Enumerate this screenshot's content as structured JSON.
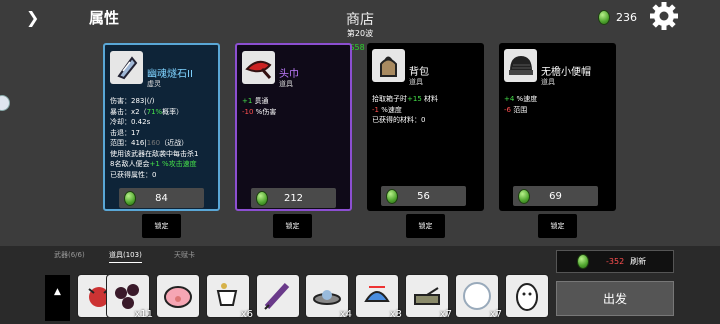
{
  "topbar": {
    "expand_icon": "chevron-right-icon",
    "title": "属性",
    "shop_title": "商店",
    "wave": "第20波",
    "fps": "FPS58",
    "currency": "236",
    "settings_icon": "gear-icon"
  },
  "cards": [
    {
      "name": "幽魂燧石II",
      "type": "虚灵",
      "name_color": "#7fd3ff",
      "price": "84",
      "lock": "锁定",
      "lines": [
        [
          {
            "t": "伤害：283|(/)"
          }
        ],
        [
          {
            "t": "暴击：x2（"
          },
          {
            "t": "71%",
            "c": "g"
          },
          {
            "t": "概率）"
          }
        ],
        [
          {
            "t": "冷却：0.42s"
          }
        ],
        [
          {
            "t": "击退：17"
          }
        ],
        [
          {
            "t": "范围：416|"
          },
          {
            "t": "160",
            "c": "gray"
          },
          {
            "t": "（近战）"
          }
        ],
        [
          {
            "t": "使用该武器在敌袭中每击杀1"
          }
        ],
        [
          {
            "t": "8名敌人便会"
          },
          {
            "t": "+1 %攻击速度",
            "c": "g"
          }
        ],
        [
          {
            "t": "已获得属性：0"
          }
        ]
      ]
    },
    {
      "name": "头巾",
      "type": "道具",
      "name_color": "#c07cff",
      "price": "212",
      "lock": "锁定",
      "lines": [
        [
          {
            "t": "+1",
            "c": "g"
          },
          {
            "t": " 贯通"
          }
        ],
        [
          {
            "t": "-10",
            "c": "r"
          },
          {
            "t": " %伤害"
          }
        ]
      ]
    },
    {
      "name": "背包",
      "type": "道具",
      "name_color": "#ffffff",
      "price": "56",
      "lock": "锁定",
      "lines": [
        [
          {
            "t": "拾取箱子时"
          },
          {
            "t": "+15",
            "c": "g"
          },
          {
            "t": " 材料"
          }
        ],
        [
          {
            "t": "-1",
            "c": "r"
          },
          {
            "t": " %速度"
          }
        ],
        [
          {
            "t": "已获得的材料：0"
          }
        ]
      ]
    },
    {
      "name": "无檐小便帽",
      "type": "道具",
      "name_color": "#ffffff",
      "price": "69",
      "lock": "锁定",
      "lines": [
        [
          {
            "t": "+4",
            "c": "g"
          },
          {
            "t": " %速度"
          }
        ],
        [
          {
            "t": "-6",
            "c": "r"
          },
          {
            "t": " 范围"
          }
        ]
      ]
    }
  ],
  "tabs": [
    {
      "label": "武器(6/6)"
    },
    {
      "label": "道具(103)"
    },
    {
      "label": "天赋卡"
    }
  ],
  "inventory": [
    {
      "icon": "bug-icon",
      "count": "x3"
    },
    {
      "icon": "berries-icon",
      "count": "x11"
    },
    {
      "icon": "pig-icon",
      "count": ""
    },
    {
      "icon": "teacup-icon",
      "count": "x6"
    },
    {
      "icon": "syringe-icon",
      "count": ""
    },
    {
      "icon": "ufo-icon",
      "count": "x4"
    },
    {
      "icon": "propeller-hat-icon",
      "count": "x3"
    },
    {
      "icon": "tank-icon",
      "count": "x7"
    },
    {
      "icon": "snowball-icon",
      "count": "x7"
    },
    {
      "icon": "egg-icon",
      "count": ""
    }
  ],
  "reroll": {
    "cost": "-352",
    "label": "刷新"
  },
  "go_label": "出发"
}
